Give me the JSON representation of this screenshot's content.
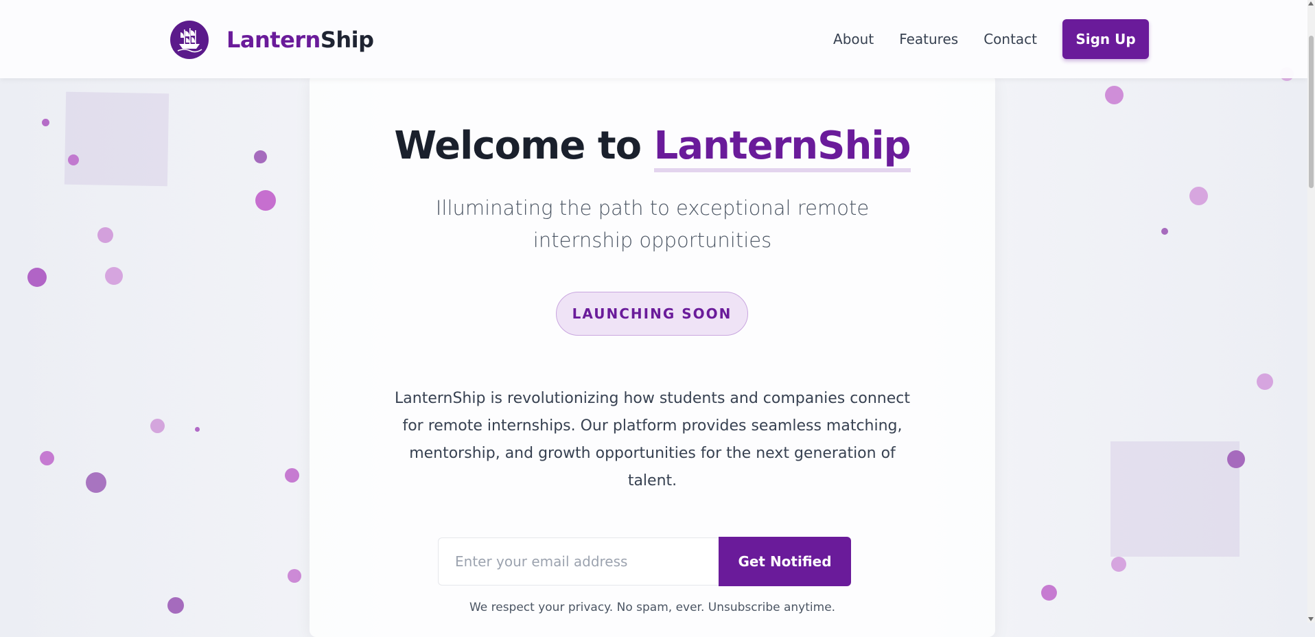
{
  "header": {
    "brand_part1": "Lantern",
    "brand_part2": "Ship",
    "logo_icon": "ship-icon",
    "nav": [
      {
        "label": "About"
      },
      {
        "label": "Features"
      },
      {
        "label": "Contact"
      }
    ],
    "signup_label": "Sign Up"
  },
  "hero": {
    "title_prefix": "Welcome to",
    "title_highlight": "LanternShip",
    "subtitle": "Illuminating the path to exceptional remote internship opportunities",
    "badge": "LAUNCHING SOON",
    "description": "LanternShip is revolutionizing how students and companies connect for remote internships. Our platform provides seamless matching, mentorship, and growth opportunities for the next generation of talent.",
    "email_placeholder": "Enter your email address",
    "email_value": "",
    "notify_label": "Get Notified",
    "privacy": "We respect your privacy. No spam, ever. Unsubscribe anytime."
  },
  "colors": {
    "brand_primary": "#6a1b9a",
    "badge_bg": "#efe3f6",
    "text_dark": "#1a202c"
  }
}
